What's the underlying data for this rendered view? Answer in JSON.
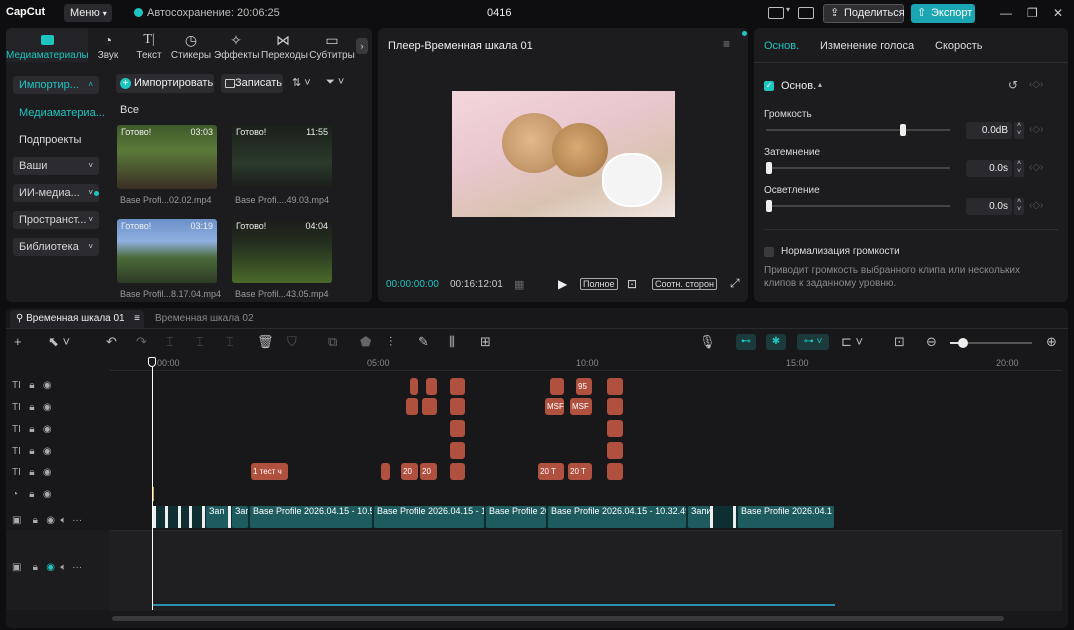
{
  "app": {
    "logo": "CapCut",
    "menu": "Меню",
    "autosave": "Автосохранение: 20:06:25",
    "project": "0416",
    "share": "Поделиться",
    "export": "Экспорт"
  },
  "media": {
    "tabs": [
      {
        "label": "Медиаматериалы",
        "icon": "media-icon"
      },
      {
        "label": "Звук",
        "icon": "audio-icon"
      },
      {
        "label": "Текст",
        "icon": "text-icon"
      },
      {
        "label": "Стикеры",
        "icon": "sticker-icon"
      },
      {
        "label": "Эффекты",
        "icon": "effects-icon"
      },
      {
        "label": "Переходы",
        "icon": "transitions-icon"
      },
      {
        "label": "Субтитры",
        "icon": "subtitles-icon"
      }
    ],
    "side": [
      "Импортир...",
      "Медиаматериа...",
      "Подпроекты",
      "Ваши",
      "ИИ-медиа...",
      "Пространст...",
      "Библиотека"
    ],
    "import_btn": "Импортировать",
    "record_btn": "Записать",
    "filter_all": "Все",
    "items": [
      {
        "status": "Готово!",
        "duration": "03:03",
        "name": "Base Profi...02.02.mp4"
      },
      {
        "status": "Готово!",
        "duration": "11:55",
        "name": "Base Profi....49.03.mp4"
      },
      {
        "status": "Готово!",
        "duration": "03:19",
        "name": "Base Profil...8.17.04.mp4"
      },
      {
        "status": "Готово!",
        "duration": "04:04",
        "name": "Base Profil...43.05.mp4"
      }
    ]
  },
  "player": {
    "title": "Плеер-Временная шкала 01",
    "current": "00:00:00:00",
    "total": "00:16:12:01",
    "full": "Полное",
    "ratio": "Соотн. сторон"
  },
  "props": {
    "tabs": [
      "Основ.",
      "Изменение голоса",
      "Скорость"
    ],
    "section": "Основ.",
    "volume_label": "Громкость",
    "volume_value": "0.0dB",
    "fadein_label": "Затемнение",
    "fadein_value": "0.0s",
    "fadeout_label": "Осветление",
    "fadeout_value": "0.0s",
    "normalize_label": "Нормализация громкости",
    "normalize_desc_1": "Приводит громкость выбранного клипа или нескольких",
    "normalize_desc_2": "клипов к заданному уровню."
  },
  "timeline": {
    "tabs": [
      "Временная шкала 01",
      "Временная шкала 02"
    ],
    "ruler": [
      "00:00",
      "05:00",
      "10:00",
      "15:00",
      "20:00"
    ],
    "text_clips": {
      "row5": [
        "1  тест ч",
        "20",
        "20",
        "20 Т",
        "20 Т"
      ],
      "row2": [
        "MSF",
        "MSF"
      ],
      "row1": [
        "95"
      ]
    },
    "video_clips": [
      "Зап",
      "Запи",
      "Base Profile 2026.04.15 - 10.58",
      "Base Profile 2026.04.15 - 12",
      "Base Profile 20",
      "Base Profile 2026.04.15 - 10.32.49",
      "Запи",
      "Base Profile 2026.04.1"
    ]
  },
  "colors": {
    "accent": "#1ec5c1",
    "export": "#1aa6b3",
    "text_clip": "#b0503f",
    "video_clip": "#1d5b5f"
  }
}
